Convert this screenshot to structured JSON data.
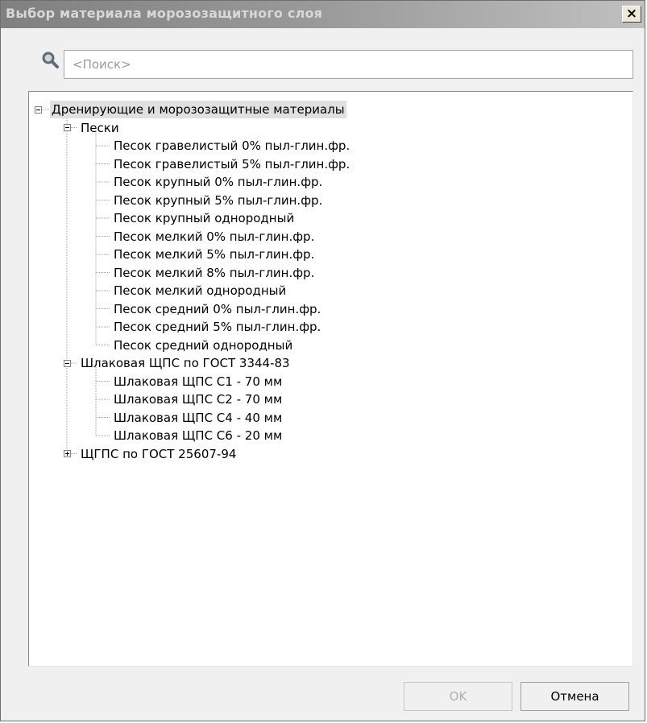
{
  "window": {
    "title": "Выбор материала морозозащитного слоя",
    "close_label": "×"
  },
  "search": {
    "placeholder": "<Поиск>",
    "value": ""
  },
  "tree": {
    "root": {
      "label": "Дренирующие и морозозащитные материалы",
      "expanded": true,
      "selected": true
    },
    "groups": [
      {
        "label": "Пески",
        "expanded": true,
        "items": [
          "Песок гравелистый 0% пыл-глин.фр.",
          "Песок гравелистый 5% пыл-глин.фр.",
          "Песок крупный 0% пыл-глин.фр.",
          "Песок крупный 5% пыл-глин.фр.",
          "Песок крупный однородный",
          "Песок мелкий 0% пыл-глин.фр.",
          "Песок мелкий 5% пыл-глин.фр.",
          "Песок мелкий 8% пыл-глин.фр.",
          "Песок мелкий однородный",
          "Песок средний 0% пыл-глин.фр.",
          "Песок средний 5% пыл-глин.фр.",
          "Песок средний однородный"
        ]
      },
      {
        "label": "Шлаковая ЩПС по ГОСТ 3344-83",
        "expanded": true,
        "items": [
          "Шлаковая ЩПС С1 - 70 мм",
          "Шлаковая ЩПС С2 - 70 мм",
          "Шлаковая ЩПС С4 - 40 мм",
          "Шлаковая ЩПС С6 - 20 мм"
        ]
      },
      {
        "label": "ЩГПС по ГОСТ 25607-94",
        "expanded": false,
        "items": []
      }
    ]
  },
  "buttons": {
    "ok_label": "OK",
    "ok_enabled": false,
    "cancel_label": "Отмена"
  },
  "colors": {
    "selection": "#e0e0e0",
    "title_text": "#d8d8d8",
    "disabled_text": "#b0b0b0"
  }
}
